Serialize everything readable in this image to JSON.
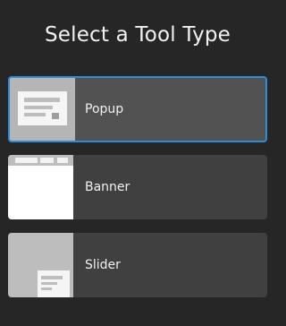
{
  "page": {
    "title": "Select a Tool Type"
  },
  "tool_types": [
    {
      "label": "Popup",
      "selected": true
    },
    {
      "label": "Banner",
      "selected": false
    },
    {
      "label": "Slider",
      "selected": false
    }
  ],
  "colors": {
    "background": "#262626",
    "card": "#404040",
    "card_selected": "#525252",
    "selection_border": "#2f8ad8"
  }
}
